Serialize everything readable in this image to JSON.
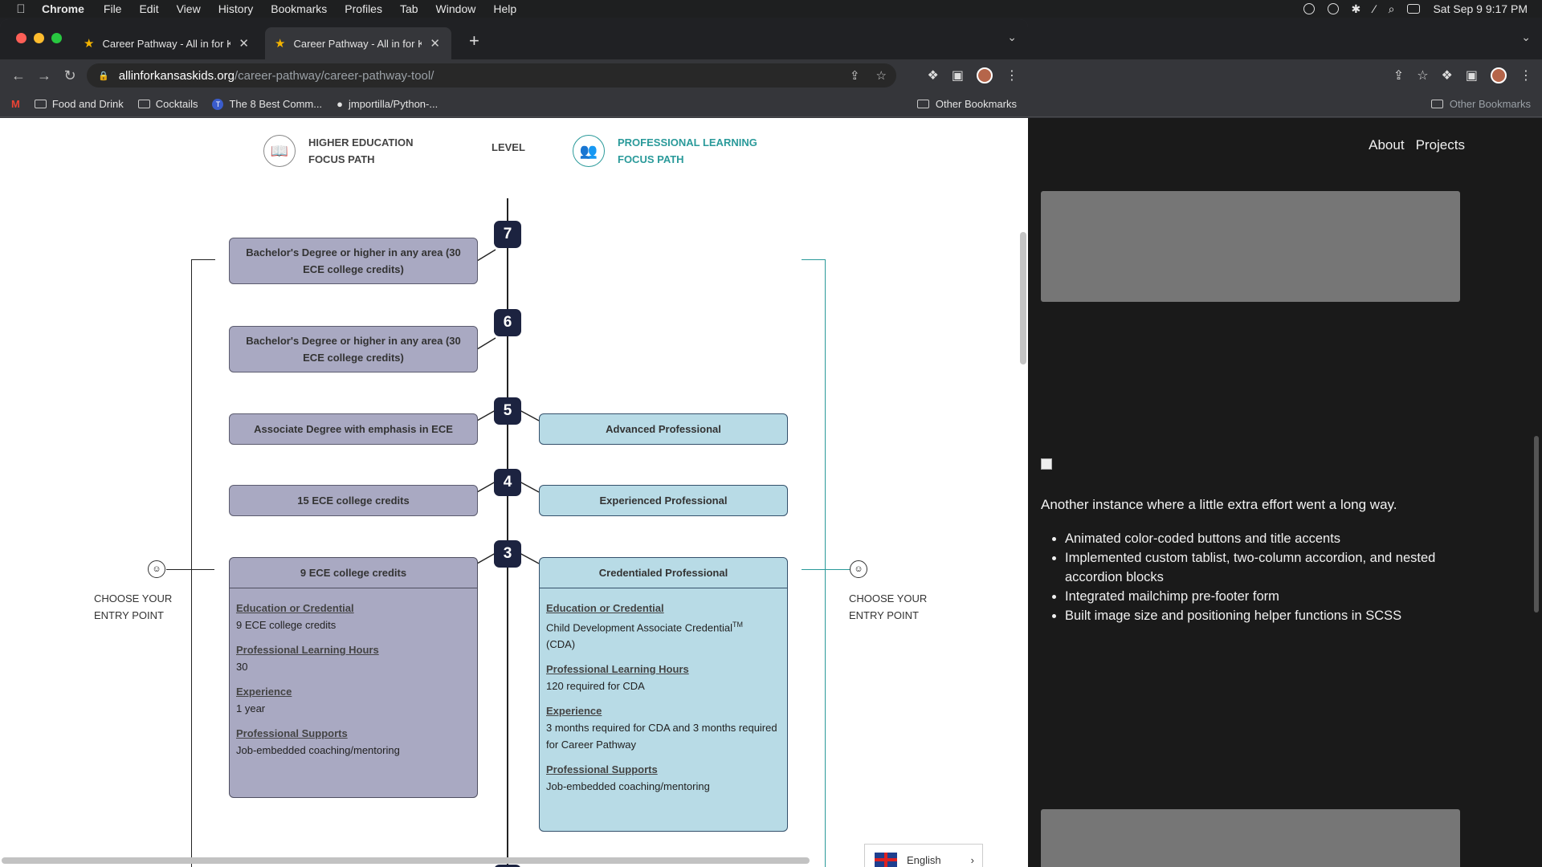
{
  "menubar": {
    "app": "Chrome",
    "items": [
      "File",
      "Edit",
      "View",
      "History",
      "Bookmarks",
      "Profiles",
      "Tab",
      "Window",
      "Help"
    ],
    "datetime": "Sat Sep 9  9:17 PM"
  },
  "tabs": [
    {
      "title": "Career Pathway - All in for Kan"
    },
    {
      "title": "Career Pathway - All in for Kan"
    }
  ],
  "address": {
    "host": "allinforkansaskids.org",
    "path": "/career-pathway/career-pathway-tool/"
  },
  "bookmarks": {
    "items": [
      "Food and Drink",
      "Cocktails",
      "The 8 Best Comm...",
      "jmportilla/Python-..."
    ],
    "other": "Other Bookmarks"
  },
  "legend": {
    "higher_ed_line1": "HIGHER EDUCATION",
    "higher_ed_line2": "FOCUS PATH",
    "level": "LEVEL",
    "pro_line1": "PROFESSIONAL LEARNING",
    "pro_line2": "FOCUS PATH"
  },
  "levels": [
    "7",
    "6",
    "5",
    "4",
    "3"
  ],
  "left_boxes": {
    "l7": "Bachelor's Degree or higher in any area (30 ECE college credits)",
    "l6": "Bachelor's Degree or higher in any area (30 ECE college credits)",
    "l5": "Associate Degree with emphasis in ECE",
    "l4": "15 ECE college credits"
  },
  "right_boxes": {
    "l5": "Advanced Professional",
    "l4": "Experienced Professional"
  },
  "left_card": {
    "title": "9 ECE college credits",
    "k1": "Education or Credential",
    "v1": "9 ECE college credits",
    "k2": "Professional Learning Hours",
    "v2": "30",
    "k3": "Experience",
    "v3": "1 year",
    "k4": "Professional Supports",
    "v4": "Job-embedded coaching/mentoring"
  },
  "right_card": {
    "title": "Credentialed Professional",
    "k1": "Education or Credential",
    "v1": "Child Development Associate Credential",
    "v1_sup": "TM",
    "v1_tail": "(CDA)",
    "k2": "Professional Learning Hours",
    "v2": "120 required for CDA",
    "k3": "Experience",
    "v3": "3 months required for CDA and 3 months required for Career Pathway",
    "k4": "Professional Supports",
    "v4": "Job-embedded coaching/mentoring"
  },
  "entry": {
    "line1": "CHOOSE YOUR",
    "line2": "ENTRY POINT"
  },
  "language": "English",
  "right_window": {
    "nav": [
      "About",
      "Projects"
    ],
    "text": "Another instance where a little extra effort went a long way.",
    "bullets": [
      "Animated color-coded buttons and title accents",
      "Implemented custom tablist, two-column accordion, and nested accordion blocks",
      "Integrated mailchimp pre-footer form",
      "Built image size and positioning helper functions in SCSS"
    ],
    "other_bookmarks": "Other Bookmarks"
  }
}
